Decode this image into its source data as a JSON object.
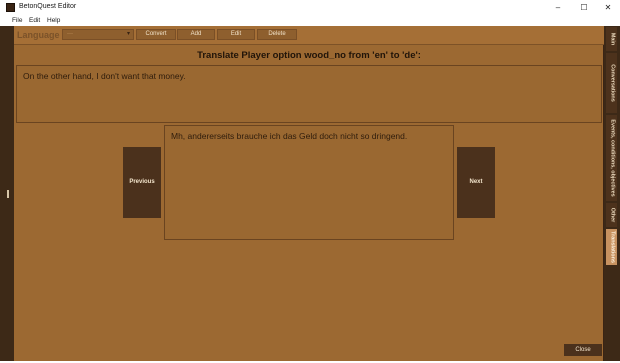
{
  "window": {
    "title": "BetonQuest Editor",
    "controls": {
      "minimize": "–",
      "maximize": "☐",
      "close": "✕"
    }
  },
  "menu": {
    "file": "File",
    "edit": "Edit",
    "help": "Help"
  },
  "toolbar": {
    "language_label": "Language",
    "language_value": "---",
    "dropdown_arrow": "▾",
    "convert": "Convert",
    "add": "Add",
    "edit": "Edit",
    "delete": "Delete"
  },
  "main": {
    "heading": "Translate Player option wood_no from 'en' to 'de':",
    "source_text": "On the other hand, I don't want that money.",
    "target_text": "Mh, andererseits brauche ich das Geld doch nicht so dringend.",
    "previous": "Previous",
    "next": "Next",
    "close": "Close"
  },
  "side_tabs": [
    {
      "label": "Main"
    },
    {
      "label": "Conversations"
    },
    {
      "label": "Events, conditions, objectives"
    },
    {
      "label": "Other"
    },
    {
      "label": "Translations"
    }
  ],
  "colors": {
    "panel": "#9c6932",
    "dark": "#46301c",
    "button": "#4b311c",
    "active_tab": "#c79260"
  }
}
